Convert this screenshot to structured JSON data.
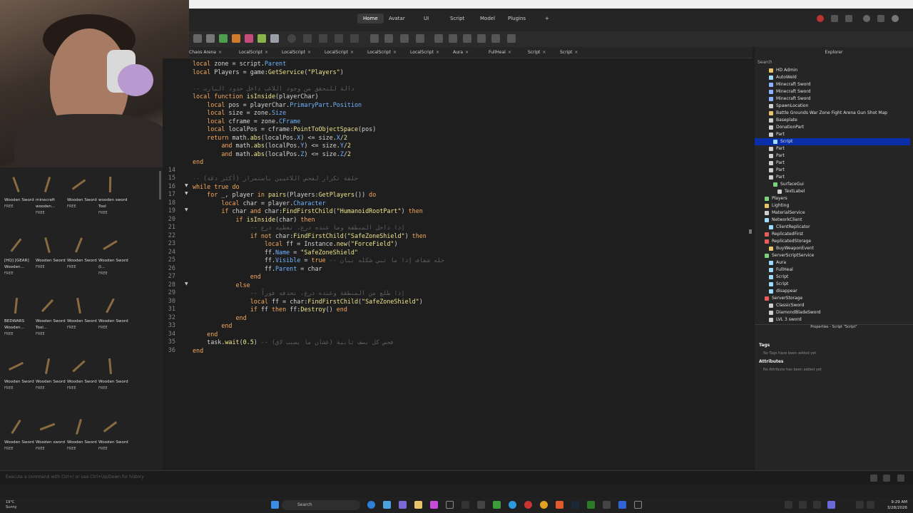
{
  "menubar": {
    "tabs": [
      "Home",
      "Avatar",
      "UI",
      "Script",
      "Model",
      "Plugins"
    ],
    "active": "Home"
  },
  "doc_tabs": [
    {
      "label": "Chaos Arena"
    },
    {
      "label": "LocalScript"
    },
    {
      "label": "LocalScript"
    },
    {
      "label": "LocalScript"
    },
    {
      "label": "LocalScript"
    },
    {
      "label": "LocalScript"
    },
    {
      "label": "Aura"
    },
    {
      "label": "FullHeal"
    },
    {
      "label": "Script"
    },
    {
      "label": "Script"
    }
  ],
  "assets": [
    {
      "name": "Wooden Sword",
      "price": "FREE"
    },
    {
      "name": "minecraft wooden...",
      "price": "FREE"
    },
    {
      "name": "Wooden Sword",
      "price": "FREE"
    },
    {
      "name": "wooden sword Tool",
      "price": "FREE"
    },
    {
      "name": "[HQ] [GEAR] Wooden...",
      "price": "FREE"
    },
    {
      "name": "Wooden Sword",
      "price": "FREE"
    },
    {
      "name": "Wooden Sword",
      "price": "FREE"
    },
    {
      "name": "Wooden Sword (I...",
      "price": "FREE"
    },
    {
      "name": "BEDWARS Wooden...",
      "price": "FREE"
    },
    {
      "name": "Wooden Sword Tool...",
      "price": "FREE"
    },
    {
      "name": "Wooden Sword",
      "price": "FREE"
    },
    {
      "name": "Wooden Sword",
      "price": "FREE"
    },
    {
      "name": "Wooden Sword",
      "price": "FREE"
    },
    {
      "name": "Wooden Sword",
      "price": "FREE"
    },
    {
      "name": "Wooden Sword",
      "price": "FREE"
    },
    {
      "name": "Wooden Sword",
      "price": "FREE"
    },
    {
      "name": "Wooden Sword",
      "price": "FREE"
    },
    {
      "name": "Wooden sword",
      "price": "FREE"
    },
    {
      "name": "Wooden Sword",
      "price": "FREE"
    },
    {
      "name": "Wooden Sword",
      "price": "FREE"
    }
  ],
  "editor": {
    "lines": [
      {
        "n": "",
        "t": "local zone = script.Parent"
      },
      {
        "n": "",
        "t": "local Players = game:GetService(\"Players\")"
      },
      {
        "n": "",
        "t": ""
      },
      {
        "n": "",
        "t": "-- دالة للتحقق من وجود اللاعب داخل حدود البارت"
      },
      {
        "n": "",
        "t": "local function isInside(playerChar)"
      },
      {
        "n": "",
        "t": "    local pos = playerChar.PrimaryPart.Position"
      },
      {
        "n": "",
        "t": "    local size = zone.Size"
      },
      {
        "n": "",
        "t": "    local cframe = zone.CFrame"
      },
      {
        "n": "",
        "t": "    local localPos = cframe:PointToObjectSpace(pos)"
      },
      {
        "n": "",
        "t": "    return math.abs(localPos.X) <= size.X/2"
      },
      {
        "n": "",
        "t": "        and math.abs(localPos.Y) <= size.Y/2"
      },
      {
        "n": "",
        "t": "        and math.abs(localPos.Z) <= size.Z/2"
      },
      {
        "n": "",
        "t": "end"
      },
      {
        "n": "14",
        "t": ""
      },
      {
        "n": "15",
        "t": "-- حلقة تكرار لفحص اللاعبين باستمرار (أكثر دقة)"
      },
      {
        "n": "16",
        "t": "while true do"
      },
      {
        "n": "17",
        "t": "    for _, player in pairs(Players:GetPlayers()) do"
      },
      {
        "n": "18",
        "t": "        local char = player.Character"
      },
      {
        "n": "19",
        "t": "        if char and char:FindFirstChild(\"HumanoidRootPart\") then"
      },
      {
        "n": "20",
        "t": "            if isInside(char) then"
      },
      {
        "n": "21",
        "t": "                -- إذا داخل المنطقة وما عنده درع، نعطيه درع"
      },
      {
        "n": "22",
        "t": "                if not char:FindFirstChild(\"SafeZoneShield\") then"
      },
      {
        "n": "23",
        "t": "                    local ff = Instance.new(\"ForceField\")"
      },
      {
        "n": "24",
        "t": "                    ff.Name = \"SafeZoneShield\""
      },
      {
        "n": "25",
        "t": "                    ff.Visible = true -- خله شفاف إذا ما تبي شكله يبان"
      },
      {
        "n": "26",
        "t": "                    ff.Parent = char"
      },
      {
        "n": "27",
        "t": "                end"
      },
      {
        "n": "28",
        "t": "            else"
      },
      {
        "n": "29",
        "t": "                -- إذا طلع من المنطقة وعنده درع، نحذفه فوراً"
      },
      {
        "n": "30",
        "t": "                local ff = char:FindFirstChild(\"SafeZoneShield\")"
      },
      {
        "n": "31",
        "t": "                if ff then ff:Destroy() end"
      },
      {
        "n": "32",
        "t": "            end"
      },
      {
        "n": "33",
        "t": "        end"
      },
      {
        "n": "34",
        "t": "    end"
      },
      {
        "n": "35",
        "t": "    task.wait(0.5) -- فحص كل نصف ثانية (عشان ما يسبب لاق)"
      },
      {
        "n": "36",
        "t": "end"
      }
    ]
  },
  "command_bar": {
    "placeholder": "Execute a command with Ctrl+/ or use Ctrl+Up/Down for history"
  },
  "explorer": {
    "title": "Explorer",
    "search_label": "Search",
    "items": [
      {
        "label": "HD Admin",
        "color": "#e8c56b",
        "depth": 1
      },
      {
        "label": "AutoWeld",
        "color": "#9cdcfe",
        "depth": 1
      },
      {
        "label": "Minecraft Sword",
        "color": "#8fb3ff",
        "depth": 1
      },
      {
        "label": "Minecraft Sword",
        "color": "#8fb3ff",
        "depth": 1
      },
      {
        "label": "Minecraft Sword",
        "color": "#8fb3ff",
        "depth": 1
      },
      {
        "label": "SpawnLocation",
        "color": "#cfcfcf",
        "depth": 1
      },
      {
        "label": "Battle Grounds War Zone Fight Arena Gun Shot Map",
        "color": "#e8c56b",
        "depth": 1
      },
      {
        "label": "Baseplate",
        "color": "#cfcfcf",
        "depth": 1
      },
      {
        "label": "DonationPart",
        "color": "#cfcfcf",
        "depth": 1
      },
      {
        "label": "Part",
        "color": "#cfcfcf",
        "depth": 1
      },
      {
        "label": "Script",
        "color": "#9cdcfe",
        "depth": 2,
        "selected": true
      },
      {
        "label": "Part",
        "color": "#cfcfcf",
        "depth": 1
      },
      {
        "label": "Part",
        "color": "#cfcfcf",
        "depth": 1
      },
      {
        "label": "Part",
        "color": "#cfcfcf",
        "depth": 1
      },
      {
        "label": "Part",
        "color": "#cfcfcf",
        "depth": 1
      },
      {
        "label": "Part",
        "color": "#cfcfcf",
        "depth": 1
      },
      {
        "label": "SurfaceGui",
        "color": "#7ed27e",
        "depth": 2
      },
      {
        "label": "TextLabel",
        "color": "#cfcfcf",
        "depth": 3
      },
      {
        "label": "Players",
        "color": "#7ed27e",
        "depth": 0
      },
      {
        "label": "Lighting",
        "color": "#e8c56b",
        "depth": 0
      },
      {
        "label": "MaterialService",
        "color": "#cfcfcf",
        "depth": 0
      },
      {
        "label": "NetworkClient",
        "color": "#9cdcfe",
        "depth": 0
      },
      {
        "label": "ClientReplicator",
        "color": "#9cdcfe",
        "depth": 1
      },
      {
        "label": "ReplicatedFirst",
        "color": "#e85c5c",
        "depth": 0
      },
      {
        "label": "ReplicatedStorage",
        "color": "#e85c5c",
        "depth": 0
      },
      {
        "label": "BuyWeaponEvent",
        "color": "#e8c56b",
        "depth": 1
      },
      {
        "label": "ServerScriptService",
        "color": "#7ed27e",
        "depth": 0
      },
      {
        "label": "Aura",
        "color": "#9cdcfe",
        "depth": 1
      },
      {
        "label": "FullHeal",
        "color": "#9cdcfe",
        "depth": 1
      },
      {
        "label": "Script",
        "color": "#9cdcfe",
        "depth": 1
      },
      {
        "label": "Script",
        "color": "#9cdcfe",
        "depth": 1
      },
      {
        "label": "disappear",
        "color": "#9cdcfe",
        "depth": 1
      },
      {
        "label": "ServerStorage",
        "color": "#e85c5c",
        "depth": 0
      },
      {
        "label": "ClassicSword",
        "color": "#cfcfcf",
        "depth": 1
      },
      {
        "label": "DiamondBladeSword",
        "color": "#cfcfcf",
        "depth": 1
      },
      {
        "label": "LVL 3 sword",
        "color": "#cfcfcf",
        "depth": 1
      }
    ]
  },
  "properties": {
    "title": "Properties - Script \"Script\"",
    "tags_label": "Tags",
    "tags_note": "No Tags have been added yet",
    "attributes_label": "Attributes",
    "attributes_note": "No Attribute has been added yet"
  },
  "taskbar": {
    "weather_temp": "19°C",
    "weather_desc": "Sunny",
    "search": "Search",
    "time": "9:29 AM",
    "date": "3/28/2026"
  }
}
